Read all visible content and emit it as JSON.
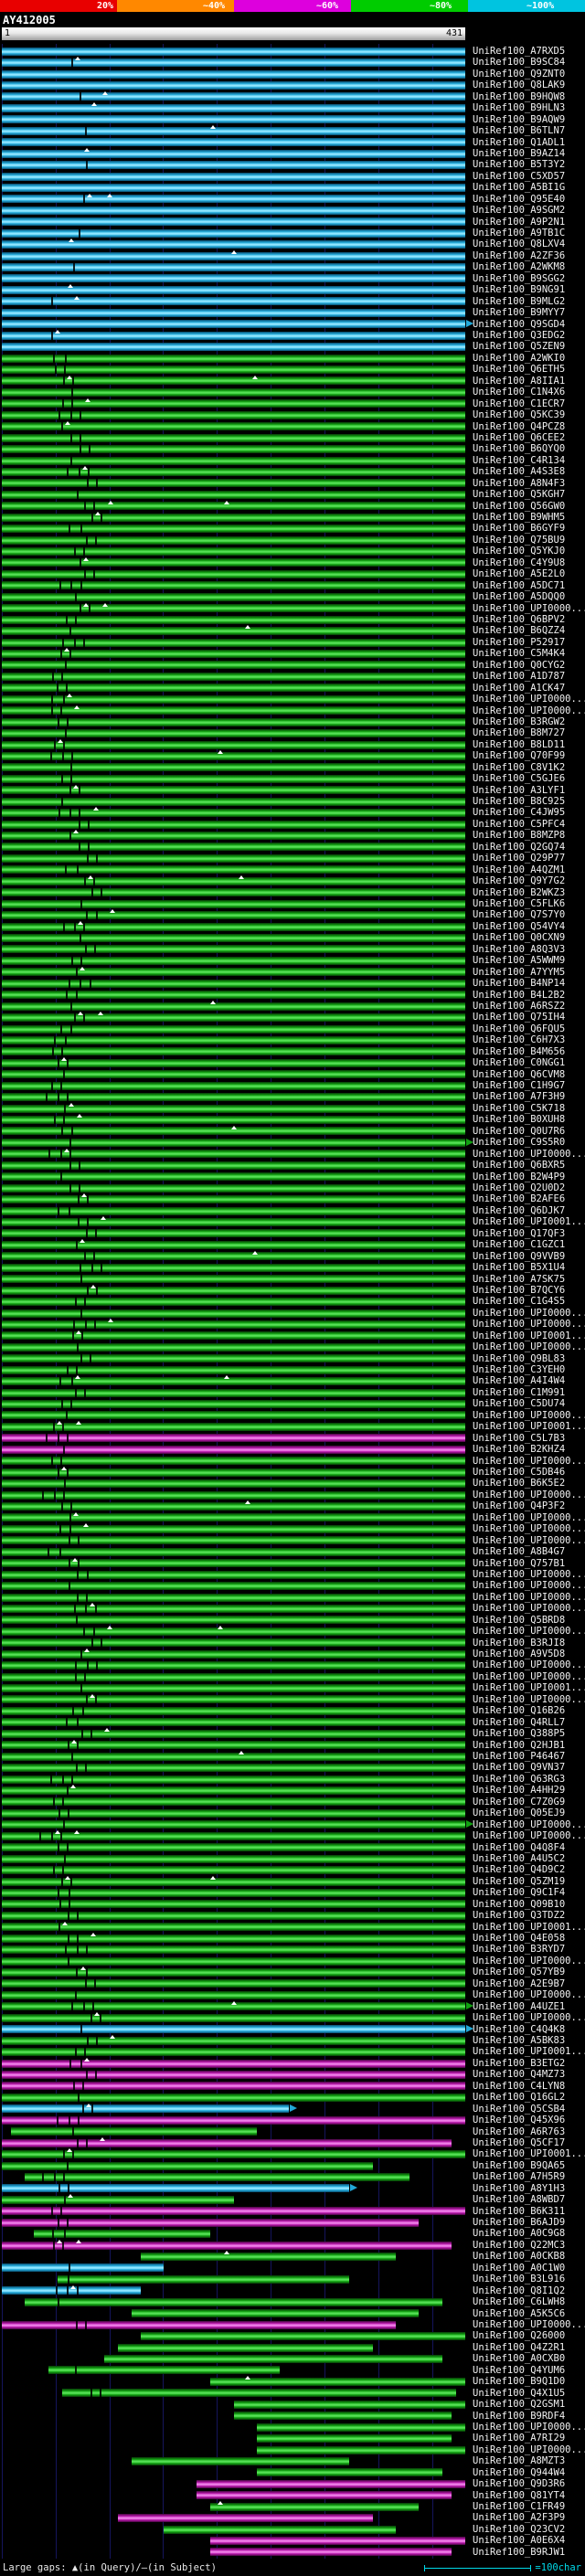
{
  "scale_bar": {
    "labels": [
      "20%",
      "~40%",
      "~60%",
      "~80%",
      "~100%"
    ],
    "colors": [
      "#e80000",
      "#ff8800",
      "#dd00dd",
      "#00cc00",
      "#00c4e0"
    ]
  },
  "query": {
    "name": "AY412005",
    "start": "1",
    "end": "431",
    "length": 431
  },
  "label_prefix": "UniRef100_",
  "palette": {
    "c": {
      "edge": "#0a4d6e",
      "mid": "#22a8d8",
      "hi": "#8fe6ff"
    },
    "g": {
      "edge": "#083908",
      "mid": "#11a011",
      "hi": "#55e055"
    },
    "m": {
      "edge": "#45083f",
      "mid": "#b515a8",
      "hi": "#ef7fe8"
    }
  },
  "marks": {
    "band_base": 0.148,
    "band_amp": 0.028,
    "band_period": 5.3
  },
  "grid": {
    "interval_chars": 50,
    "color": "#15155c"
  },
  "footer": {
    "gaps_legend": "Large gaps: ▲(in Query)/—(in Subject)",
    "scale_label": "=100char",
    "scale_chars": 100
  },
  "chart_data": {
    "type": "bar",
    "orientation": "horizontal",
    "x_unit": "query characters 1-431",
    "bins": {
      "c": "~100%",
      "g": "~80%",
      "m": "~60%"
    },
    "row_key": "l = UniRef100 id suffix, c = identity bin, s/e = aligned query fraction, a = subject extends arrow",
    "rows": [
      {
        "l": "A7RXD5",
        "c": "c"
      },
      {
        "l": "B9SC84",
        "c": "c"
      },
      {
        "l": "Q9ZNT0",
        "c": "c"
      },
      {
        "l": "Q8LAK9",
        "c": "c"
      },
      {
        "l": "B9HQW8",
        "c": "c"
      },
      {
        "l": "B9HLN3",
        "c": "c"
      },
      {
        "l": "B9AQW9",
        "c": "c"
      },
      {
        "l": "B6TLN7",
        "c": "c"
      },
      {
        "l": "Q1ADL1",
        "c": "c"
      },
      {
        "l": "B9AZ14",
        "c": "c"
      },
      {
        "l": "B5T3Y2",
        "c": "c"
      },
      {
        "l": "C5XD57",
        "c": "c"
      },
      {
        "l": "A5BI1G",
        "c": "c"
      },
      {
        "l": "Q95E40",
        "c": "c"
      },
      {
        "l": "A9SGM2",
        "c": "c"
      },
      {
        "l": "A9P2N1",
        "c": "c"
      },
      {
        "l": "A9TB1C",
        "c": "c"
      },
      {
        "l": "Q8LXV4",
        "c": "c"
      },
      {
        "l": "A2ZF36",
        "c": "c"
      },
      {
        "l": "A2WKM8",
        "c": "c"
      },
      {
        "l": "B9SGG2",
        "c": "c"
      },
      {
        "l": "B9NG91",
        "c": "c"
      },
      {
        "l": "B9MLG2",
        "c": "c"
      },
      {
        "l": "B9MYY7",
        "c": "c"
      },
      {
        "l": "Q9SGD4",
        "c": "c",
        "a": 1
      },
      {
        "l": "Q3EDG2",
        "c": "c"
      },
      {
        "l": "Q5ZEN9",
        "c": "c"
      },
      {
        "l": "A2WKI0",
        "c": "g"
      },
      {
        "l": "Q6ETH5",
        "c": "g"
      },
      {
        "l": "A8IIA1",
        "c": "g"
      },
      {
        "l": "C1N4X6",
        "c": "g"
      },
      {
        "l": "C1ECR7",
        "c": "g"
      },
      {
        "l": "Q5KC39",
        "c": "g"
      },
      {
        "l": "Q4PCZ8",
        "c": "g"
      },
      {
        "l": "Q6CEE2",
        "c": "g"
      },
      {
        "l": "B6QYQ0",
        "c": "g"
      },
      {
        "l": "C4R134",
        "c": "g"
      },
      {
        "l": "A4S3E8",
        "c": "g"
      },
      {
        "l": "A8N4F3",
        "c": "g"
      },
      {
        "l": "Q5KGH7",
        "c": "g"
      },
      {
        "l": "Q56GW0",
        "c": "g"
      },
      {
        "l": "B9WHM5",
        "c": "g"
      },
      {
        "l": "B6GYF9",
        "c": "g"
      },
      {
        "l": "Q75BU9",
        "c": "g"
      },
      {
        "l": "Q5YKJ0",
        "c": "g"
      },
      {
        "l": "C4Y9U8",
        "c": "g"
      },
      {
        "l": "A5E2L0",
        "c": "g"
      },
      {
        "l": "A5DC71",
        "c": "g"
      },
      {
        "l": "A5DQQ0",
        "c": "g"
      },
      {
        "l": "UPI0000...",
        "c": "g"
      },
      {
        "l": "Q6BPV2",
        "c": "g"
      },
      {
        "l": "B6QZZ4",
        "c": "g"
      },
      {
        "l": "P52917",
        "c": "g"
      },
      {
        "l": "C5M4K4",
        "c": "g"
      },
      {
        "l": "Q0CYG2",
        "c": "g"
      },
      {
        "l": "A1D787",
        "c": "g"
      },
      {
        "l": "A1CK47",
        "c": "g"
      },
      {
        "l": "UPI0000...",
        "c": "g"
      },
      {
        "l": "UPI0000...",
        "c": "g"
      },
      {
        "l": "B3RGW2",
        "c": "g"
      },
      {
        "l": "B8M727",
        "c": "g"
      },
      {
        "l": "B8LD11",
        "c": "g"
      },
      {
        "l": "Q70F99",
        "c": "g"
      },
      {
        "l": "C8V1K2",
        "c": "g"
      },
      {
        "l": "C5GJE6",
        "c": "g"
      },
      {
        "l": "A3LYF1",
        "c": "g"
      },
      {
        "l": "B8C925",
        "c": "g"
      },
      {
        "l": "C4JW95",
        "c": "g"
      },
      {
        "l": "C5PFC4",
        "c": "g"
      },
      {
        "l": "B8MZP8",
        "c": "g"
      },
      {
        "l": "Q2GQ74",
        "c": "g"
      },
      {
        "l": "Q29P77",
        "c": "g"
      },
      {
        "l": "A4QZM1",
        "c": "g"
      },
      {
        "l": "Q9Y7G2",
        "c": "g"
      },
      {
        "l": "B2WKZ3",
        "c": "g"
      },
      {
        "l": "C5FLK6",
        "c": "g"
      },
      {
        "l": "Q7S7Y0",
        "c": "g"
      },
      {
        "l": "Q54VY4",
        "c": "g"
      },
      {
        "l": "Q0CXN9",
        "c": "g"
      },
      {
        "l": "A8Q3V3",
        "c": "g"
      },
      {
        "l": "A5WWM9",
        "c": "g"
      },
      {
        "l": "A7YYM5",
        "c": "g"
      },
      {
        "l": "B4NP14",
        "c": "g"
      },
      {
        "l": "B4L2B2",
        "c": "g"
      },
      {
        "l": "A6RSZ2",
        "c": "g"
      },
      {
        "l": "Q75IH4",
        "c": "g"
      },
      {
        "l": "Q6FQU5",
        "c": "g"
      },
      {
        "l": "C6H7X3",
        "c": "g"
      },
      {
        "l": "B4M656",
        "c": "g"
      },
      {
        "l": "C0NGG1",
        "c": "g"
      },
      {
        "l": "Q6CVM8",
        "c": "g"
      },
      {
        "l": "C1H9G7",
        "c": "g"
      },
      {
        "l": "A7F3H9",
        "c": "g"
      },
      {
        "l": "C5K718",
        "c": "g"
      },
      {
        "l": "B0XUH8",
        "c": "g"
      },
      {
        "l": "Q0U7R6",
        "c": "g"
      },
      {
        "l": "C9S5R0",
        "c": "g",
        "a": 1
      },
      {
        "l": "UPI0000...",
        "c": "g"
      },
      {
        "l": "Q6BXR5",
        "c": "g"
      },
      {
        "l": "B2W4P9",
        "c": "g"
      },
      {
        "l": "Q2U0D2",
        "c": "g"
      },
      {
        "l": "B2AFE6",
        "c": "g"
      },
      {
        "l": "Q6DJK7",
        "c": "g"
      },
      {
        "l": "UPI0001...",
        "c": "g"
      },
      {
        "l": "Q17QF3",
        "c": "g"
      },
      {
        "l": "C1GZC1",
        "c": "g"
      },
      {
        "l": "Q9VVB9",
        "c": "g"
      },
      {
        "l": "B5X1U4",
        "c": "g"
      },
      {
        "l": "A7SK75",
        "c": "g"
      },
      {
        "l": "B7QCY6",
        "c": "g"
      },
      {
        "l": "C1G4S5",
        "c": "g"
      },
      {
        "l": "UPI0000...",
        "c": "g"
      },
      {
        "l": "UPI0000...",
        "c": "g"
      },
      {
        "l": "UPI0001...",
        "c": "g"
      },
      {
        "l": "UPI0000...",
        "c": "g"
      },
      {
        "l": "Q9BL83",
        "c": "g"
      },
      {
        "l": "C3YEH0",
        "c": "g"
      },
      {
        "l": "A4I4W4",
        "c": "g"
      },
      {
        "l": "C1M991",
        "c": "g"
      },
      {
        "l": "C5DU74",
        "c": "g"
      },
      {
        "l": "UPI0000...",
        "c": "g"
      },
      {
        "l": "UPI0001...",
        "c": "g"
      },
      {
        "l": "C5L7B3",
        "c": "m"
      },
      {
        "l": "B2KHZ4",
        "c": "m"
      },
      {
        "l": "UPI0000...",
        "c": "g"
      },
      {
        "l": "C5DB46",
        "c": "g"
      },
      {
        "l": "B6K5E2",
        "c": "g"
      },
      {
        "l": "UPI0000...",
        "c": "g"
      },
      {
        "l": "Q4P3F2",
        "c": "g"
      },
      {
        "l": "UPI0000...",
        "c": "g"
      },
      {
        "l": "UPI0000...",
        "c": "g"
      },
      {
        "l": "UPI0000...",
        "c": "g"
      },
      {
        "l": "A8B4G7",
        "c": "g"
      },
      {
        "l": "Q757B1",
        "c": "g"
      },
      {
        "l": "UPI0000...",
        "c": "g"
      },
      {
        "l": "UPI0000...",
        "c": "g"
      },
      {
        "l": "UPI0000...",
        "c": "g"
      },
      {
        "l": "UPI0000...",
        "c": "g"
      },
      {
        "l": "Q5BRD8",
        "c": "g"
      },
      {
        "l": "UPI0000...",
        "c": "g"
      },
      {
        "l": "B3RJI8",
        "c": "g"
      },
      {
        "l": "A9V5D8",
        "c": "g"
      },
      {
        "l": "UPI0000...",
        "c": "g"
      },
      {
        "l": "UPI0000...",
        "c": "g"
      },
      {
        "l": "UPI0001...",
        "c": "g"
      },
      {
        "l": "UPI0000...",
        "c": "g"
      },
      {
        "l": "Q16B26",
        "c": "g"
      },
      {
        "l": "Q4RLL7",
        "c": "g"
      },
      {
        "l": "Q388P5",
        "c": "g"
      },
      {
        "l": "Q2HJB1",
        "c": "g"
      },
      {
        "l": "P46467",
        "c": "g"
      },
      {
        "l": "Q9VN37",
        "c": "g"
      },
      {
        "l": "Q63RG3",
        "c": "g"
      },
      {
        "l": "A4HH29",
        "c": "g"
      },
      {
        "l": "C7Z0G9",
        "c": "g"
      },
      {
        "l": "Q05EJ9",
        "c": "g"
      },
      {
        "l": "UPI0000...",
        "c": "g",
        "a": 1
      },
      {
        "l": "UPI0000...",
        "c": "g"
      },
      {
        "l": "Q4Q8F4",
        "c": "g"
      },
      {
        "l": "A4U5C2",
        "c": "g"
      },
      {
        "l": "Q4D9C2",
        "c": "g"
      },
      {
        "l": "Q5ZM19",
        "c": "g"
      },
      {
        "l": "Q9C1F4",
        "c": "g"
      },
      {
        "l": "Q09B10",
        "c": "g"
      },
      {
        "l": "Q3TDZ2",
        "c": "g"
      },
      {
        "l": "UPI0001...",
        "c": "g"
      },
      {
        "l": "Q4E058",
        "c": "g"
      },
      {
        "l": "B3RYD7",
        "c": "g"
      },
      {
        "l": "UPI0000...",
        "c": "g"
      },
      {
        "l": "Q57YB9",
        "c": "g"
      },
      {
        "l": "A2E9B7",
        "c": "g"
      },
      {
        "l": "UPI0000...",
        "c": "g"
      },
      {
        "l": "A4UZE1",
        "c": "g",
        "a": 1
      },
      {
        "l": "UPI0000...",
        "c": "g"
      },
      {
        "l": "C4Q4K8",
        "c": "c",
        "a": 1
      },
      {
        "l": "A5BK83",
        "c": "g"
      },
      {
        "l": "UPI0001...",
        "c": "g"
      },
      {
        "l": "B3ETG2",
        "c": "m"
      },
      {
        "l": "Q4MZ73",
        "c": "m"
      },
      {
        "l": "C4LYN8",
        "c": "m"
      },
      {
        "l": "Q16GL2",
        "c": "g"
      },
      {
        "l": "Q5CSB4",
        "c": "c",
        "s": 0,
        "e": 0.62,
        "a": 1
      },
      {
        "l": "Q45X96",
        "c": "m"
      },
      {
        "l": "A6R763",
        "c": "g",
        "s": 0.02,
        "e": 0.55
      },
      {
        "l": "Q5CF17",
        "c": "m",
        "s": 0,
        "e": 0.97
      },
      {
        "l": "UPI0001...",
        "c": "g"
      },
      {
        "l": "B9QA65",
        "c": "g",
        "s": 0,
        "e": 0.8
      },
      {
        "l": "A7H5R9",
        "c": "g",
        "s": 0.05,
        "e": 0.88
      },
      {
        "l": "A8Y1H3",
        "c": "c",
        "s": 0,
        "e": 0.75,
        "a": 1
      },
      {
        "l": "A8WBD7",
        "c": "g",
        "s": 0,
        "e": 0.5
      },
      {
        "l": "B6K311",
        "c": "m"
      },
      {
        "l": "B6AJD9",
        "c": "m",
        "s": 0,
        "e": 0.9
      },
      {
        "l": "A0C9G8",
        "c": "g",
        "s": 0.07,
        "e": 0.45
      },
      {
        "l": "Q22MC3",
        "c": "m",
        "s": 0,
        "e": 0.97
      },
      {
        "l": "A0CKB8",
        "c": "g",
        "s": 0.3,
        "e": 0.85
      },
      {
        "l": "A0C1W0",
        "c": "c",
        "s": 0,
        "e": 0.35
      },
      {
        "l": "B3L916",
        "c": "g",
        "s": 0.12,
        "e": 0.75
      },
      {
        "l": "Q8I1Q2",
        "c": "c",
        "s": 0,
        "e": 0.3
      },
      {
        "l": "C6LWH8",
        "c": "g",
        "s": 0.05,
        "e": 0.95
      },
      {
        "l": "A5K5C6",
        "c": "g",
        "s": 0.28,
        "e": 0.9
      },
      {
        "l": "UPI0000...",
        "c": "m",
        "s": 0,
        "e": 0.85
      },
      {
        "l": "Q26000",
        "c": "g",
        "s": 0.3,
        "e": 1
      },
      {
        "l": "Q4Z2R1",
        "c": "g",
        "s": 0.25,
        "e": 0.8
      },
      {
        "l": "A0CXB0",
        "c": "g",
        "s": 0.22,
        "e": 0.95
      },
      {
        "l": "Q4YUM6",
        "c": "g",
        "s": 0.1,
        "e": 0.6
      },
      {
        "l": "B9Q1D0",
        "c": "g",
        "s": 0.45,
        "e": 1
      },
      {
        "l": "Q4X1U5",
        "c": "g",
        "s": 0.13,
        "e": 0.98
      },
      {
        "l": "Q2GSM1",
        "c": "g",
        "s": 0.5,
        "e": 1
      },
      {
        "l": "B9RDF4",
        "c": "g",
        "s": 0.5,
        "e": 0.97
      },
      {
        "l": "UPI0000...",
        "c": "g",
        "s": 0.55,
        "e": 1
      },
      {
        "l": "A7RI29",
        "c": "g",
        "s": 0.55,
        "e": 0.97
      },
      {
        "l": "UPI0000...",
        "c": "g",
        "s": 0.55,
        "e": 1
      },
      {
        "l": "A8MZT3",
        "c": "g",
        "s": 0.28,
        "e": 0.75
      },
      {
        "l": "Q944W4",
        "c": "g",
        "s": 0.55,
        "e": 0.95
      },
      {
        "l": "Q9D3R6",
        "c": "m",
        "s": 0.42,
        "e": 1
      },
      {
        "l": "Q81YT4",
        "c": "m",
        "s": 0.42,
        "e": 0.97
      },
      {
        "l": "C1FR49",
        "c": "g",
        "s": 0.45,
        "e": 0.9
      },
      {
        "l": "A2F3P9",
        "c": "m",
        "s": 0.25,
        "e": 0.8
      },
      {
        "l": "Q23CV2",
        "c": "g",
        "s": 0.35,
        "e": 0.85
      },
      {
        "l": "A0E6X4",
        "c": "m",
        "s": 0.45,
        "e": 1
      },
      {
        "l": "B9RJW1",
        "c": "m",
        "s": 0.45,
        "e": 0.97
      }
    ]
  }
}
